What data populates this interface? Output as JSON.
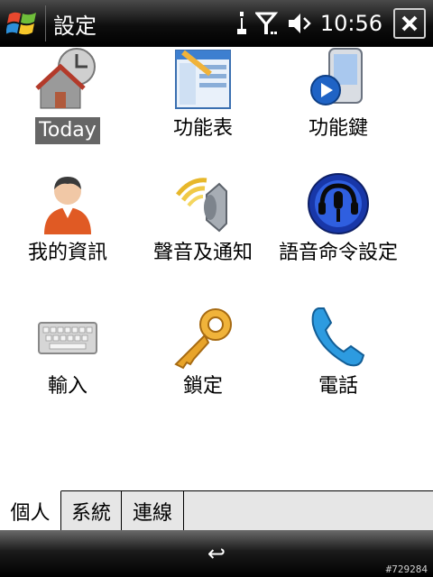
{
  "titlebar": {
    "title": "設定",
    "time": "10:56"
  },
  "icons": [
    {
      "label": "Today",
      "icon": "today-clock-house-icon",
      "selected": true
    },
    {
      "label": "功能表",
      "icon": "menu-window-icon"
    },
    {
      "label": "功能鍵",
      "icon": "phone-device-play-icon"
    },
    {
      "label": "我的資訊",
      "icon": "person-icon"
    },
    {
      "label": "聲音及通知",
      "icon": "speaker-icon"
    },
    {
      "label": "語音命令設定",
      "icon": "microphone-headset-icon"
    },
    {
      "label": "輸入",
      "icon": "keyboard-icon"
    },
    {
      "label": "鎖定",
      "icon": "key-icon"
    },
    {
      "label": "電話",
      "icon": "phone-handset-icon"
    }
  ],
  "tabs": [
    {
      "label": "個人",
      "active": true
    },
    {
      "label": "系統"
    },
    {
      "label": "連線"
    }
  ],
  "softbar": {
    "back_glyph": "↩"
  },
  "watermark": "#729284"
}
